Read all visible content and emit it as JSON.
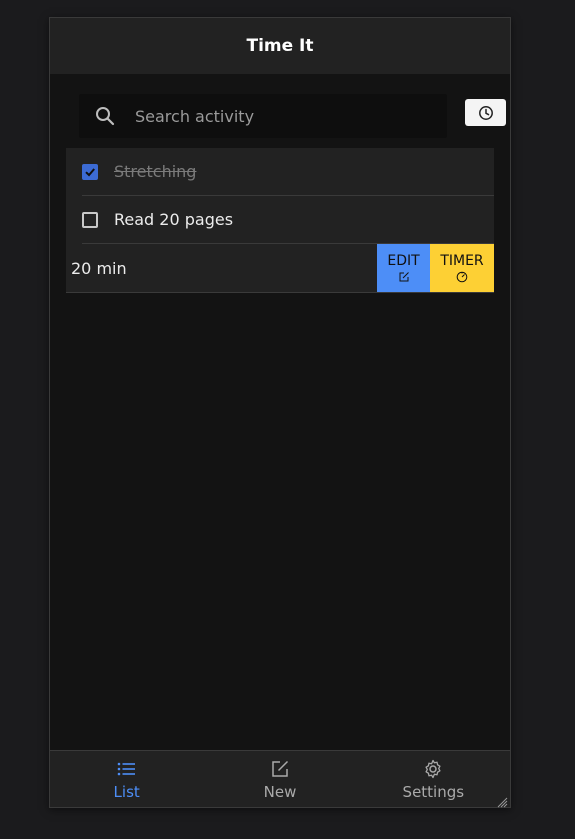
{
  "header": {
    "title": "Time It"
  },
  "search": {
    "placeholder": "Search activity",
    "value": "",
    "icon": "search-icon"
  },
  "history_button": {
    "icon": "clock-icon"
  },
  "activities": [
    {
      "label": "Stretching",
      "checked": true
    },
    {
      "label": "Read 20 pages",
      "checked": false
    }
  ],
  "detail": {
    "duration": "20 min",
    "edit_label": "EDIT",
    "edit_icon": "edit-icon",
    "timer_label": "TIMER",
    "timer_icon": "timer-icon"
  },
  "nav": {
    "items": [
      {
        "label": "List",
        "icon": "list-icon",
        "active": true
      },
      {
        "label": "New",
        "icon": "edit-icon",
        "active": false
      },
      {
        "label": "Settings",
        "icon": "gear-icon",
        "active": false
      }
    ]
  },
  "colors": {
    "accent": "#4d8ef7",
    "timer": "#fdd034",
    "checkbox": "#3c6bd4",
    "background": "#131313",
    "surface": "#222222"
  }
}
